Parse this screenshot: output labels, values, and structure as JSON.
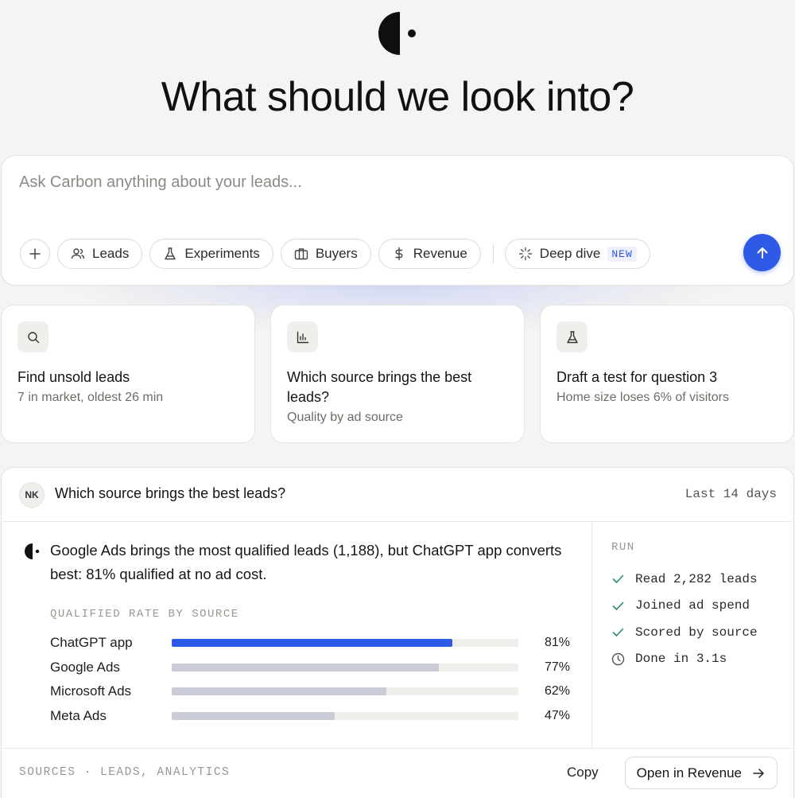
{
  "headline": "What should we look into?",
  "prompt": {
    "placeholder": "Ask Carbon anything about your leads...",
    "chips": [
      {
        "label": "Leads",
        "icon": "users-icon"
      },
      {
        "label": "Experiments",
        "icon": "flask-icon"
      },
      {
        "label": "Buyers",
        "icon": "briefcase-icon"
      },
      {
        "label": "Revenue",
        "icon": "dollar-icon"
      }
    ],
    "deep_dive": {
      "label": "Deep dive",
      "badge": "NEW"
    },
    "accent_color": "#2f5ae8"
  },
  "cards": [
    {
      "icon": "search-icon",
      "title": "Find unsold leads",
      "subtitle": "7 in market, oldest 26 min"
    },
    {
      "icon": "bar-chart-icon",
      "title": "Which source brings the best leads?",
      "subtitle": "Quality by ad source"
    },
    {
      "icon": "flask-icon",
      "title": "Draft a test for question 3",
      "subtitle": "Home size loses 6% of visitors"
    }
  ],
  "result": {
    "avatar": "NK",
    "question": "Which source brings the best leads?",
    "range": "Last 14 days",
    "answer": "Google Ads brings the most qualified leads (1,188), but ChatGPT app converts best: 81% qualified at no ad cost.",
    "chart_label": "QUALIFIED RATE BY SOURCE",
    "run_label": "RUN",
    "run_steps": [
      {
        "text": "Read 2,282 leads",
        "icon": "check-icon"
      },
      {
        "text": "Joined ad spend",
        "icon": "check-icon"
      },
      {
        "text": "Scored by source",
        "icon": "check-icon"
      },
      {
        "text": "Done in 3.1s",
        "icon": "clock-icon"
      }
    ],
    "sources": "SOURCES · LEADS, ANALYTICS",
    "copy_label": "Copy",
    "open_label": "Open in Revenue"
  },
  "chart_data": {
    "type": "bar",
    "orientation": "horizontal",
    "title": "QUALIFIED RATE BY SOURCE",
    "categories": [
      "ChatGPT app",
      "Google Ads",
      "Microsoft Ads",
      "Meta Ads"
    ],
    "values": [
      81,
      77,
      62,
      47
    ],
    "value_labels": [
      "81%",
      "77%",
      "62%",
      "47%"
    ],
    "xlim": [
      0,
      100
    ],
    "highlight_color": "#2f5ae8",
    "bar_color": "#c9ccd6"
  }
}
